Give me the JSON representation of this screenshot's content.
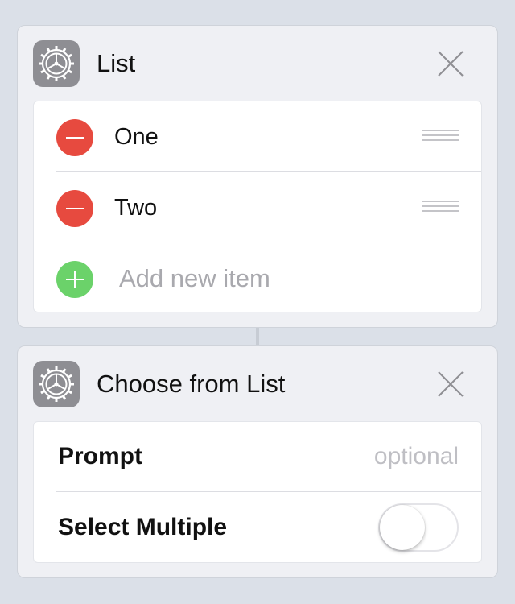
{
  "cards": [
    {
      "title": "List",
      "icon": "gear-icon",
      "items": [
        {
          "label": "One"
        },
        {
          "label": "Two"
        }
      ],
      "add_placeholder": "Add new item"
    },
    {
      "title": "Choose from List",
      "icon": "gear-icon",
      "params": {
        "prompt": {
          "label": "Prompt",
          "placeholder": "optional"
        },
        "select_multiple": {
          "label": "Select Multiple",
          "enabled": false
        }
      }
    }
  ],
  "colors": {
    "background": "#dbe0e8",
    "remove": "#e74a3f",
    "add": "#6bd26a",
    "icon_bg": "#8e8e93"
  }
}
